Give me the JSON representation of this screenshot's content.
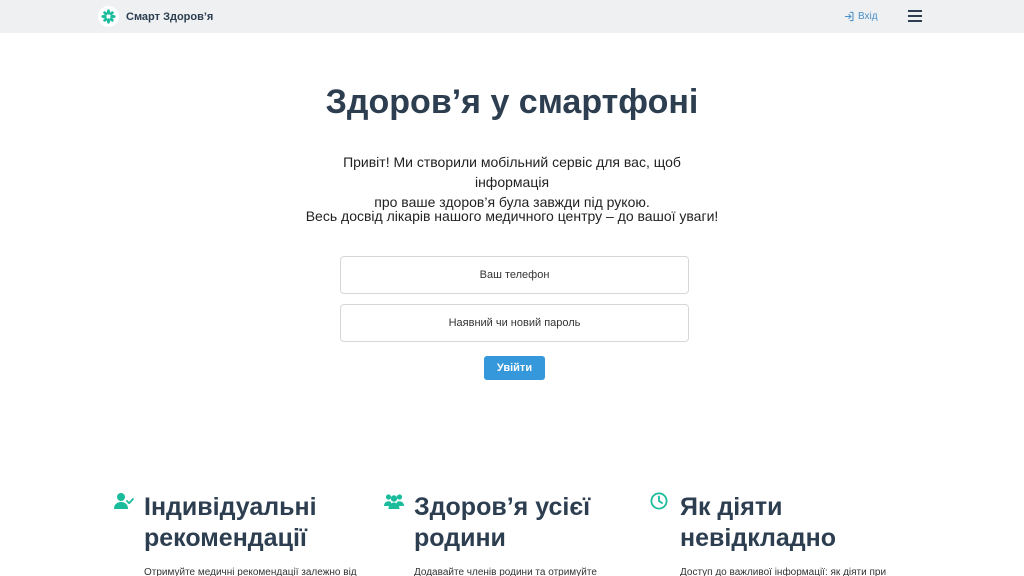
{
  "navbar": {
    "brand_name": "Смарт Здоров’я",
    "login_label": "Вхід",
    "accent_color": "#1abc9c",
    "link_color": "#4a90c8"
  },
  "hero": {
    "title": "Здоров’я у смартфоні",
    "intro_line1": "Привіт! Ми створили мобільний сервіс для вас, щоб інформація",
    "intro_line2": "про ваше здоров’я була завжди під рукою.",
    "intro_2": "Весь досвід лікарів нашого медичного центру – до вашої уваги!"
  },
  "form": {
    "phone_placeholder": "Ваш телефон",
    "password_placeholder": "Наявний чи новий пароль",
    "submit_label": "Увійти",
    "button_color": "#3498db"
  },
  "features": [
    {
      "icon": "user-check-icon",
      "title_line1": "Індивідуальні",
      "title_line2": "рекомендації",
      "text": "Отримуйте медичні рекомендації залежно від"
    },
    {
      "icon": "users-icon",
      "title_line1": "Здоров’я усієї",
      "title_line2": "родини",
      "text": "Додавайте членів родини та отримуйте"
    },
    {
      "icon": "clock-icon",
      "title_line1": "Як діяти",
      "title_line2": "невідкладно",
      "text": "Доступ до важливої інформації: як діяти при"
    }
  ]
}
